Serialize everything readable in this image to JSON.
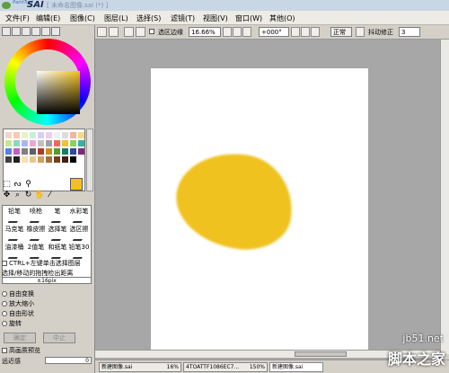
{
  "app": {
    "title_prefix": "PaintTool",
    "title_main": "SAI",
    "document_title": "[ 未命名图像.sai (*) ]"
  },
  "menu": [
    "文件(F)",
    "编辑(E)",
    "图像(C)",
    "图层(L)",
    "选择(S)",
    "滤镜(T)",
    "视图(V)",
    "窗口(W)",
    "其他(O)"
  ],
  "toolbar": {
    "selection_edge_label": "选区边缘",
    "zoom": "16.66%",
    "rotation": "+000°",
    "blend_mode": "正常",
    "stabilizer_label": "抖动修正",
    "stabilizer_value": "3"
  },
  "tools": {
    "brushes": [
      [
        "铅笔",
        "喷枪",
        "笔",
        "水彩笔"
      ],
      [
        "马克笔",
        "橡皮擦",
        "选择笔",
        "选区擦"
      ],
      [
        "油漆桶",
        "2值笔",
        "和纸笔",
        "铅笔30"
      ]
    ],
    "ctrl_option": "CTRL+左键单击选择图层",
    "drag_label": "选择/移动的拖拽检出距离",
    "drag_value": "±16pix",
    "transform_options": [
      "自由变换",
      "放大缩小",
      "自由形状",
      "旋转"
    ],
    "ok_button": "确定",
    "cancel_button": "中止",
    "hq_preview": "高画质预览",
    "smoothing_label": "远近感",
    "smoothing_value": "0"
  },
  "taskbar": [
    {
      "name": "新建图像.sai",
      "zoom": "16%"
    },
    {
      "name": "4TOATTF1086EC7...",
      "zoom": "150%"
    },
    {
      "name": "新建图像.sai",
      "zoom": ""
    }
  ],
  "watermark": {
    "site": "jb51.net",
    "brand": "脚本之家"
  },
  "colors": {
    "current": "#f2c21a",
    "blob": "#f0c21f",
    "workspace": "#a7a7a7"
  }
}
